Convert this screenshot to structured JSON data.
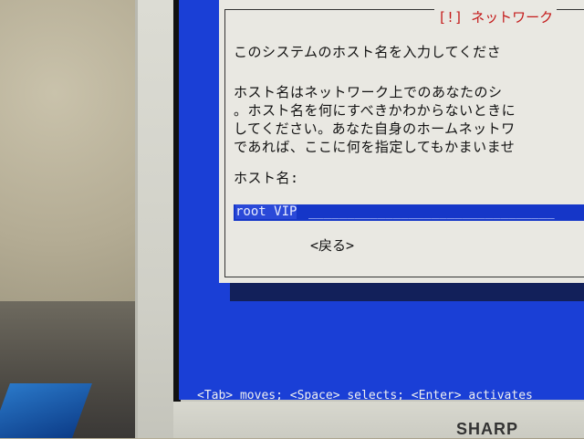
{
  "dialog": {
    "title": "[!] ネットワーク",
    "prompt": "このシステムのホスト名を入力してくださ",
    "description": [
      "ホスト名はネットワーク上でのあなたのシ",
      "。ホスト名を何にすべきかわからないときに",
      "してください。あなた自身のホームネットワ",
      "であれば、ここに何を指定してもかまいませ"
    ],
    "field_label": "ホスト名:",
    "hostname_value": "root VIP",
    "field_fill": "________________________________",
    "back_button": "<戻る>"
  },
  "status_bar": "<Tab> moves; <Space> selects; <Enter> activates",
  "brand_logo": "SHARP",
  "colors": {
    "screen_bg": "#1a3fd6",
    "dialog_bg": "#e9e8e2",
    "title_red": "#c41a1a",
    "input_bg": "#1536c8"
  }
}
